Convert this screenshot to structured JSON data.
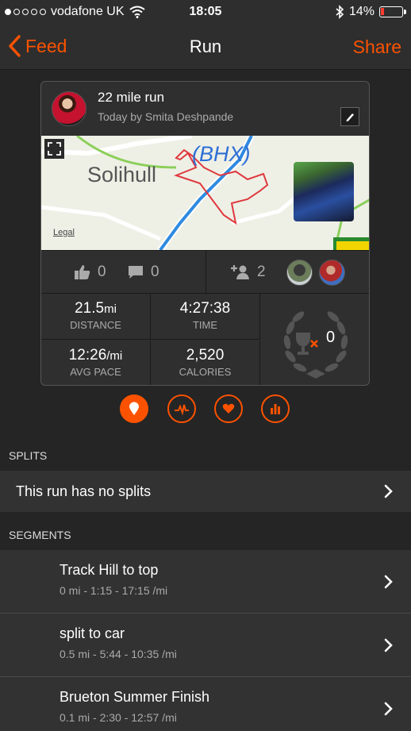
{
  "status_bar": {
    "carrier": "vodafone UK",
    "time": "18:05",
    "battery": "14%",
    "battery_level": 0.14,
    "signal_bars": 1,
    "signal_total": 5
  },
  "nav": {
    "back_label": "Feed",
    "title": "Run",
    "share_label": "Share",
    "accent": "#fc5200"
  },
  "activity": {
    "title": "22 mile run",
    "subtitle": "Today by Smita Deshpande"
  },
  "map": {
    "town_label": "Solihull",
    "airport_label": "(BHX)",
    "legal_label": "Legal"
  },
  "social": {
    "kudos_count": "0",
    "comment_count": "0",
    "athletes_count": "2"
  },
  "stats": {
    "distance_value": "21.5",
    "distance_unit": "mi",
    "distance_label": "DISTANCE",
    "time_value": "4:27:38",
    "time_label": "TIME",
    "pace_value": "12:26",
    "pace_unit": "/mi",
    "pace_label": "AVG PACE",
    "calories_value": "2,520",
    "calories_label": "CALORIES",
    "achievements_count": "0"
  },
  "tabs": [
    "map-pin-icon",
    "pulse-icon",
    "heart-icon",
    "bar-chart-icon"
  ],
  "splits": {
    "header": "SPLITS",
    "empty_text": "This run has no splits"
  },
  "segments": {
    "header": "SEGMENTS",
    "items": [
      {
        "name": "Track Hill to top",
        "meta": "0 mi - 1:15 - 17:15 /mi"
      },
      {
        "name": "split to car",
        "meta": "0.5 mi - 5:44 - 10:35 /mi"
      },
      {
        "name": "Brueton Summer Finish",
        "meta": "0.1 mi - 2:30 - 12:57 /mi"
      }
    ]
  }
}
